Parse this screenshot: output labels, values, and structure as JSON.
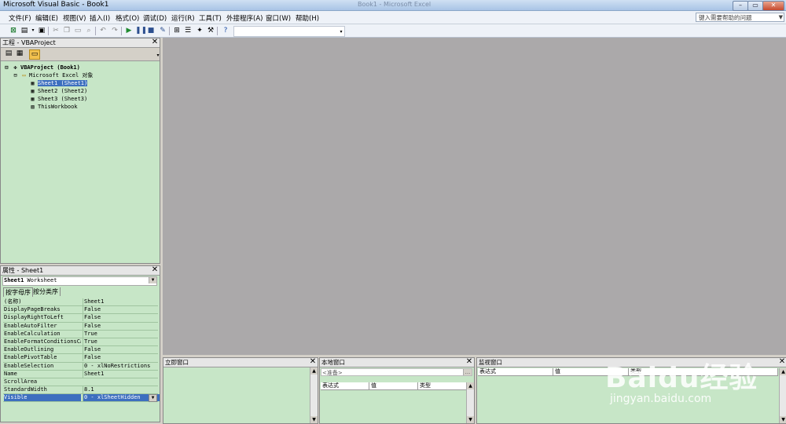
{
  "window": {
    "title": "Microsoft Visual Basic - Book1",
    "background_title": "Book1 - Microsoft Excel",
    "controls": {
      "minimize": "–",
      "maximize": "▭",
      "close": "✕"
    }
  },
  "menu": {
    "items": [
      "文件(F)",
      "编辑(E)",
      "视图(V)",
      "插入(I)",
      "格式(O)",
      "调试(D)",
      "运行(R)",
      "工具(T)",
      "外接程序(A)",
      "窗口(W)",
      "帮助(H)"
    ],
    "help_placeholder": "键入需要帮助的问题"
  },
  "toolbar": {
    "icons": [
      "excel-icon",
      "insert-module-icon",
      "save-icon",
      "cut-icon",
      "copy-icon",
      "paste-icon",
      "find-icon",
      "undo-icon",
      "redo-icon",
      "run-icon",
      "break-icon",
      "reset-icon",
      "design-mode-icon",
      "project-explorer-icon",
      "properties-icon",
      "object-browser-icon",
      "toolbox-icon",
      "help-icon"
    ]
  },
  "project_panel": {
    "title": "工程 - VBAProject",
    "tree": [
      {
        "label": "VBAProject (Book1)",
        "level": 0,
        "icon": "project-icon",
        "bold": true
      },
      {
        "label": "Microsoft Excel 对象",
        "level": 1,
        "icon": "folder-icon"
      },
      {
        "label": "Sheet1 (Sheet1)",
        "level": 2,
        "icon": "sheet-icon",
        "selected": true
      },
      {
        "label": "Sheet2 (Sheet2)",
        "level": 2,
        "icon": "sheet-icon"
      },
      {
        "label": "Sheet3 (Sheet3)",
        "level": 2,
        "icon": "sheet-icon"
      },
      {
        "label": "ThisWorkbook",
        "level": 2,
        "icon": "workbook-icon"
      }
    ]
  },
  "properties_panel": {
    "title": "属性 - Sheet1",
    "object": "Sheet1",
    "object_type": "Worksheet",
    "tabs": [
      "按字母序",
      "按分类序"
    ],
    "rows": [
      {
        "name": "(名称)",
        "value": "Sheet1"
      },
      {
        "name": "DisplayPageBreaks",
        "value": "False"
      },
      {
        "name": "DisplayRightToLeft",
        "value": "False"
      },
      {
        "name": "EnableAutoFilter",
        "value": "False"
      },
      {
        "name": "EnableCalculation",
        "value": "True"
      },
      {
        "name": "EnableFormatConditionsCalc",
        "value": "True"
      },
      {
        "name": "EnableOutlining",
        "value": "False"
      },
      {
        "name": "EnablePivotTable",
        "value": "False"
      },
      {
        "name": "EnableSelection",
        "value": "0 - xlNoRestrictions"
      },
      {
        "name": "Name",
        "value": "Sheet1"
      },
      {
        "name": "ScrollArea",
        "value": ""
      },
      {
        "name": "StandardWidth",
        "value": "8.1"
      },
      {
        "name": "Visible",
        "value": "0 - xlSheetHidden",
        "selected": true
      }
    ]
  },
  "immediate": {
    "title": "立即窗口"
  },
  "locals": {
    "title": "本地窗口",
    "context": "<准备>",
    "context_button": "...",
    "columns": [
      "表达式",
      "值",
      "类型"
    ]
  },
  "watch": {
    "title": "监视窗口",
    "columns": [
      "表达式",
      "值",
      "类型"
    ]
  },
  "watermark": {
    "brand": "Baidu经验",
    "site": "jingyan.baidu.com"
  },
  "colors": {
    "panel_bg": "#c7e6c7",
    "mdi_bg": "#aba9aa",
    "selection": "#3d6fbf",
    "chrome": "#eef2f8"
  }
}
